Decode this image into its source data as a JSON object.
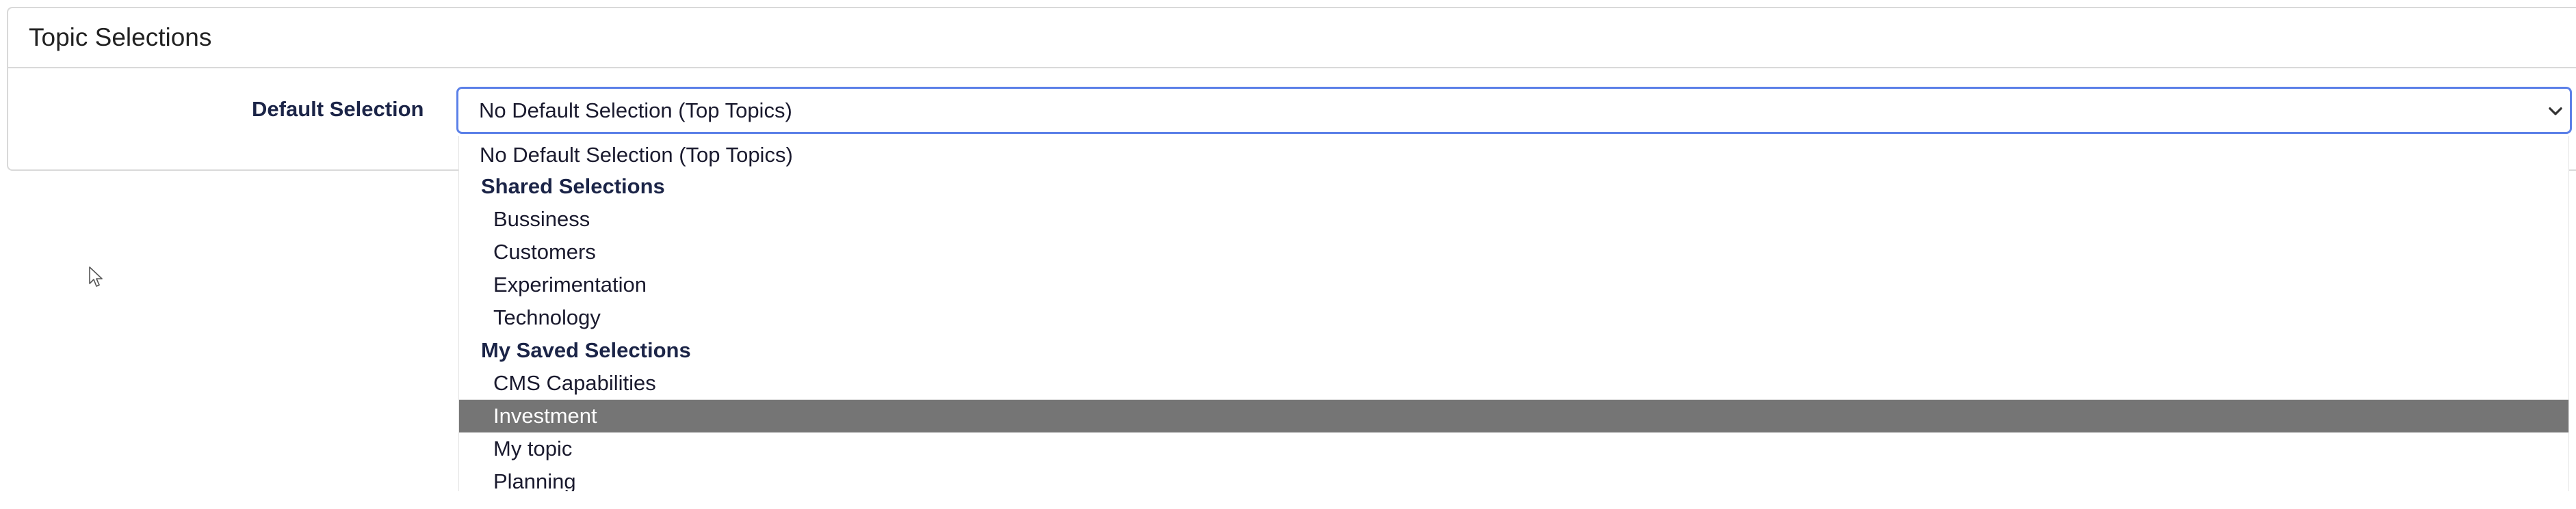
{
  "panel": {
    "title": "Topic Selections"
  },
  "field": {
    "label": "Default Selection",
    "selected_value": "No Default Selection (Top Topics)"
  },
  "dropdown": {
    "default_option": "No Default Selection (Top Topics)",
    "groups": [
      {
        "label": "Shared Selections",
        "items": [
          "Bussiness",
          "Customers",
          "Experimentation",
          "Technology"
        ]
      },
      {
        "label": "My Saved Selections",
        "items": [
          "CMS Capabilities",
          "Investment",
          "My topic",
          "Planning"
        ]
      }
    ],
    "highlighted_item": "Investment",
    "highlight_color": "#757575"
  },
  "colors": {
    "focus_border": "#5b80e8",
    "label_text": "#1b2447",
    "panel_border": "#d9d9d9"
  },
  "icons": {
    "chevron": "chevron-down-icon",
    "cursor": "mouse-pointer-icon"
  }
}
